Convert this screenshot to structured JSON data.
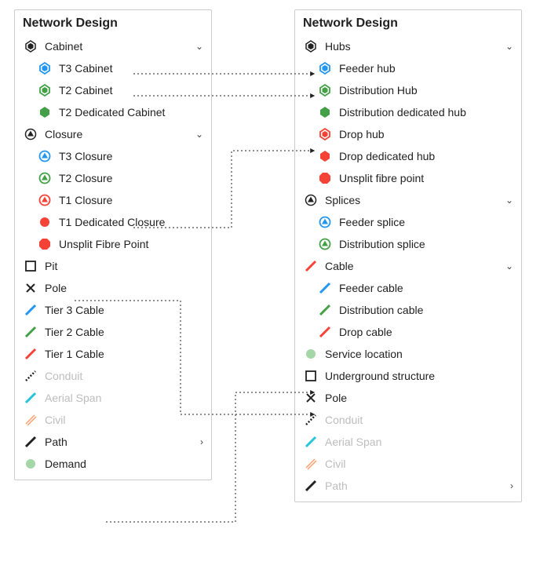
{
  "title_left": "Network Design",
  "title_right": "Network Design",
  "colors": {
    "blue": "#2196f3",
    "green": "#43a047",
    "red": "#f44336",
    "lime": "#a5d6a7",
    "teal": "#26c6da",
    "orange": "#ff9e6d",
    "black": "#222",
    "grey": "#bdbdbd"
  },
  "left": {
    "cabinet": {
      "label": "Cabinet",
      "items": [
        {
          "label": "T3 Cabinet"
        },
        {
          "label": "T2 Cabinet"
        },
        {
          "label": "T2 Dedicated Cabinet"
        }
      ]
    },
    "closure": {
      "label": "Closure",
      "items": [
        {
          "label": "T3 Closure"
        },
        {
          "label": "T2 Closure"
        },
        {
          "label": "T1 Closure"
        },
        {
          "label": "T1 Dedicated Closure"
        },
        {
          "label": "Unsplit Fibre Point"
        }
      ]
    },
    "rest": [
      {
        "label": "Pit"
      },
      {
        "label": "Pole"
      },
      {
        "label": "Tier 3 Cable"
      },
      {
        "label": "Tier 2 Cable"
      },
      {
        "label": "Tier 1 Cable"
      },
      {
        "label": "Conduit"
      },
      {
        "label": "Aerial Span"
      },
      {
        "label": "Civil"
      },
      {
        "label": "Path"
      },
      {
        "label": "Demand"
      }
    ]
  },
  "right": {
    "hubs": {
      "label": "Hubs",
      "items": [
        {
          "label": "Feeder hub"
        },
        {
          "label": "Distribution Hub"
        },
        {
          "label": "Distribution dedicated hub"
        },
        {
          "label": "Drop hub"
        },
        {
          "label": "Drop dedicated hub"
        },
        {
          "label": "Unsplit fibre point"
        }
      ]
    },
    "splices": {
      "label": "Splices",
      "items": [
        {
          "label": "Feeder splice"
        },
        {
          "label": "Distribution splice"
        }
      ]
    },
    "cable": {
      "label": "Cable",
      "items": [
        {
          "label": "Feeder cable"
        },
        {
          "label": "Distribution cable"
        },
        {
          "label": "Drop cable"
        }
      ]
    },
    "rest": [
      {
        "label": "Service location"
      },
      {
        "label": "Underground structure"
      },
      {
        "label": "Pole"
      },
      {
        "label": "Conduit"
      },
      {
        "label": "Aerial Span"
      },
      {
        "label": "Civil"
      },
      {
        "label": "Path"
      }
    ]
  }
}
